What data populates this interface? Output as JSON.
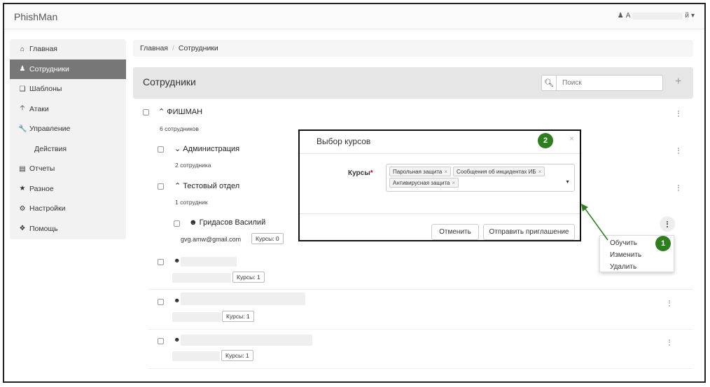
{
  "app": {
    "title": "PhishMan"
  },
  "user": {
    "name_start": "А",
    "name_end": "й"
  },
  "sidebar": {
    "items": [
      {
        "label": "Главная",
        "icon": "home-icon"
      },
      {
        "label": "Сотрудники",
        "icon": "users-icon"
      },
      {
        "label": "Шаблоны",
        "icon": "copy-icon"
      },
      {
        "label": "Атаки",
        "icon": "arrow-up-icon"
      },
      {
        "label": "Управление",
        "icon": "wrench-icon"
      },
      {
        "label": "Действия",
        "icon": ""
      },
      {
        "label": "Отчеты",
        "icon": "report-icon"
      },
      {
        "label": "Разное",
        "icon": "star-icon"
      },
      {
        "label": "Настройки",
        "icon": "cogs-icon"
      },
      {
        "label": "Помощь",
        "icon": "info-icon"
      }
    ]
  },
  "breadcrumb": {
    "home": "Главная",
    "sep": "/",
    "current": "Сотрудники"
  },
  "panel": {
    "title": "Сотрудники",
    "search_placeholder": "Поиск",
    "add": "+"
  },
  "tree": {
    "root": {
      "title": "ФИШМАН",
      "count": "6 сотрудников"
    },
    "dept1": {
      "title": "Администрация",
      "count": "2 сотрудника"
    },
    "dept2": {
      "title": "Тестовый отдел",
      "count": "1 сотрудник"
    },
    "person1": {
      "name": "Гридасов Василий",
      "email": "gvg.amw@gmail.com",
      "courses": "Курсы: 0"
    },
    "person2": {
      "courses": "Курсы: 1"
    },
    "person3": {
      "courses": "Курсы: 1"
    },
    "person4": {
      "courses": "Курсы: 1"
    }
  },
  "context_menu": {
    "items": [
      "Обучить",
      "Изменить",
      "Удалить"
    ]
  },
  "modal": {
    "title": "Выбор курсов",
    "close": "×",
    "field_label": "Курсы",
    "required_mark": "*",
    "chips": [
      "Парольная защита",
      "Сообщения об инцидентах ИБ",
      "Антивирусная защита"
    ],
    "cancel": "Отменить",
    "submit": "Отправить приглашение"
  },
  "annotations": {
    "badge1": "1",
    "badge2": "2"
  },
  "colors": {
    "accent": "#2e7d1f",
    "active_nav": "#777777",
    "required": "#cc0000"
  }
}
